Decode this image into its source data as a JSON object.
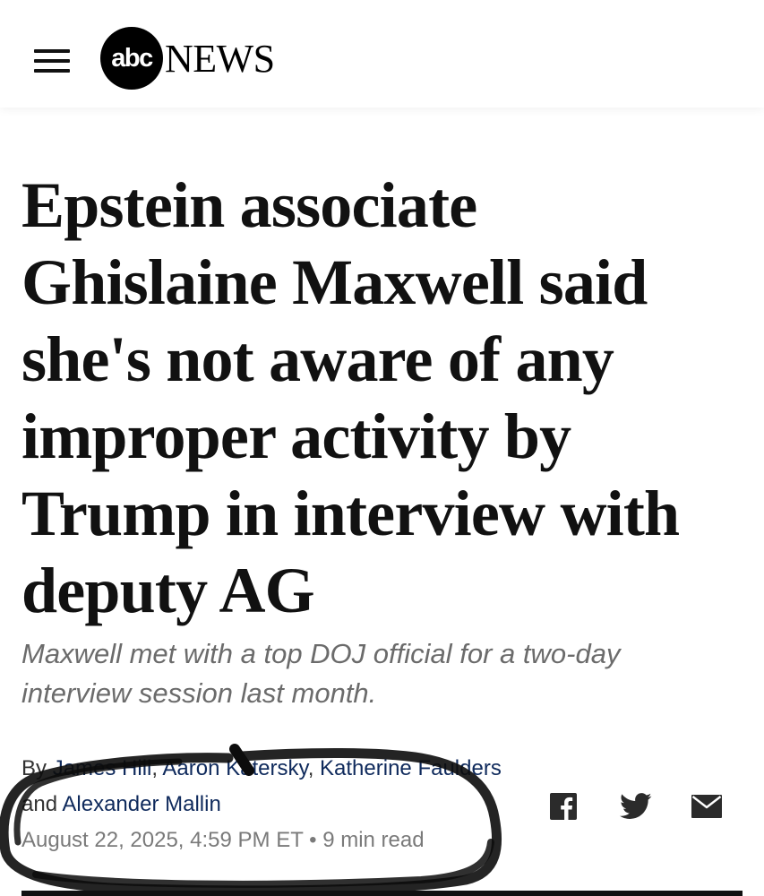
{
  "header": {
    "logo_abc": "abc",
    "logo_news": "NEWS"
  },
  "article": {
    "headline": "Epstein associate Ghislaine Maxwell said she's not aware of any improper activity by Trump in interview with deputy AG",
    "subheadline": "Maxwell met with a top DOJ official for a two-day interview session last month.",
    "byline": {
      "prefix": "By",
      "authors": [
        "James Hill",
        "Aaron Katersky",
        "Katherine Faulders",
        "Alexander Mallin"
      ],
      "separator": ", ",
      "conjunction": "and"
    },
    "date": "August 22, 2025, 4:59 PM ET",
    "bullet": "•",
    "read_time": "9 min read"
  },
  "share": {
    "icons": [
      "facebook-icon",
      "twitter-icon",
      "email-icon"
    ]
  },
  "colors": {
    "author_link": "#0f2a5c",
    "subhead": "#6b6b6b",
    "meta": "#7a7a7a",
    "social_icon": "#2b2b2b",
    "marker": "#0c0c0c"
  }
}
